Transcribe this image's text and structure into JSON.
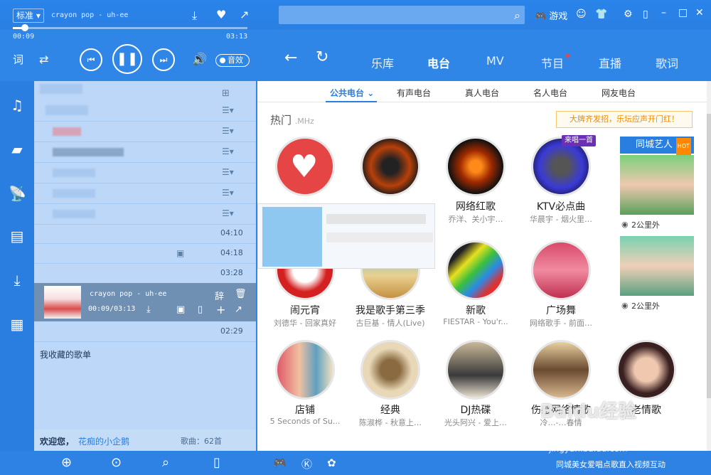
{
  "player": {
    "quality": "标准",
    "song": "crayon pop - uh-ee",
    "elapsed": "00:09",
    "total": "03:13",
    "progress": 0.05,
    "effect": "音效"
  },
  "topbar": {
    "search_placeholder": "",
    "game": "游戏"
  },
  "nav": {
    "tabs": [
      "乐库",
      "电台",
      "MV",
      "节目",
      "直播",
      "歌词"
    ],
    "active": "电台"
  },
  "subtabs": [
    "公共电台",
    "有声电台",
    "真人电台",
    "名人电台",
    "网友电台"
  ],
  "hot": {
    "title": "热门",
    "unit": ".MHz"
  },
  "promo": "大牌齐发招，乐坛应声开门红！",
  "stations": [
    {
      "name": "",
      "sub": ""
    },
    {
      "name": "",
      "sub": ""
    },
    {
      "name": "网络红歌",
      "sub": "乔洋、关小宇…"
    },
    {
      "name": "KTV必点曲",
      "sub": "华晨宇 - 烟火里…",
      "badge": "来唱一首"
    },
    {
      "name": "闹元宵",
      "sub": "刘德华 - 回家真好"
    },
    {
      "name": "我是歌手第三季",
      "sub": "古巨基 - 情人(Live)"
    },
    {
      "name": "新歌",
      "sub": "FIESTAR - You'r..."
    },
    {
      "name": "广场舞",
      "sub": "网络歌手 - 前面…"
    },
    {
      "name": "店铺",
      "sub": "5 Seconds of Su..."
    },
    {
      "name": "经典",
      "sub": "陈淑桦 - 秋意上…"
    },
    {
      "name": "DJ热碟",
      "sub": "光头阿兴 - 爱上…"
    },
    {
      "name": "伤感网络情歌",
      "sub": "冷…-…春情"
    },
    {
      "name": "老情歌",
      "sub": ""
    }
  ],
  "artists": {
    "title": "同城艺人",
    "hot": "HOT",
    "items": [
      {
        "distance": "2公里外"
      },
      {
        "distance": "2公里外"
      }
    ]
  },
  "playlist": {
    "rows": [
      {
        "dur": ""
      },
      {
        "dur": ""
      },
      {
        "dur": ""
      },
      {
        "dur": ""
      },
      {
        "dur": ""
      },
      {
        "dur": ""
      },
      {
        "dur": "04:10"
      },
      {
        "dur": "04:18"
      },
      {
        "dur": "03:28"
      }
    ],
    "now": {
      "title": "crayon pop - uh-ee",
      "time": "00:09/03:13"
    },
    "after": {
      "dur": "02:29"
    },
    "fav": "我收藏的歌单"
  },
  "welcome": {
    "greet": "欢迎您，",
    "user": "花痴的小企鹅",
    "count": "歌曲：62首"
  },
  "bottom": {
    "text": "同城美女爱唱点歌直入视频互动"
  },
  "watermark": {
    "brand": "Baidu经验",
    "url": "jingyan.baidu.com"
  }
}
